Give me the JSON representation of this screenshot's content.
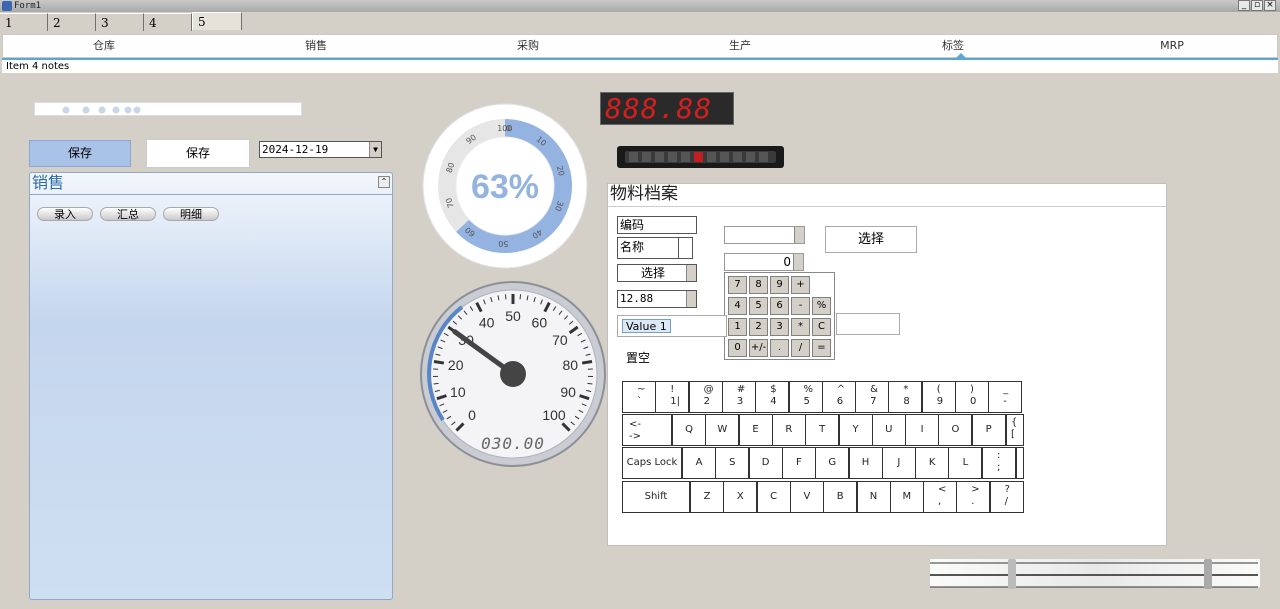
{
  "window": {
    "title": "Form1"
  },
  "top_tabs": [
    "1",
    "2",
    "3",
    "4",
    "5"
  ],
  "nav": {
    "items": [
      "仓库",
      "销售",
      "采购",
      "生产",
      "标签",
      "MRP"
    ],
    "selected_index": 4
  },
  "notes": "Item 4 notes",
  "toolbar": {
    "save_label_1": "保存",
    "save_label_2": "保存",
    "date_value": "2024-12-19"
  },
  "sales_panel": {
    "title": "销售",
    "buttons": [
      "录入",
      "汇总",
      "明细"
    ]
  },
  "progress_gauge": {
    "label": "63%",
    "value": 63,
    "ticks": [
      "0",
      "10",
      "20",
      "30",
      "40",
      "50",
      "60",
      "70",
      "80",
      "90",
      "100"
    ]
  },
  "led_display": {
    "text": "888.88"
  },
  "speedometer": {
    "ticks": [
      "0",
      "10",
      "20",
      "30",
      "40",
      "50",
      "60",
      "70",
      "80",
      "90",
      "100"
    ],
    "value": 30,
    "readout": "030.00"
  },
  "material_panel": {
    "title": "物料档案",
    "code_label": "编码",
    "name_label": "名称",
    "select_label": "选择",
    "select_button": "选择",
    "price_value": "12.88",
    "number_value": "0",
    "value_tag": "Value 1",
    "clear_label": "置空",
    "calculator": [
      [
        "7",
        "8",
        "9",
        "+",
        ""
      ],
      [
        "4",
        "5",
        "6",
        "-",
        "%"
      ],
      [
        "1",
        "2",
        "3",
        "*",
        "C"
      ],
      [
        "0",
        "+/-",
        ".",
        "/",
        "="
      ]
    ]
  },
  "keyboard": {
    "row1": [
      [
        "~",
        "`"
      ],
      [
        "!",
        "1|"
      ],
      [
        "@",
        "2"
      ],
      [
        "#",
        "3"
      ],
      [
        "$",
        "4"
      ],
      [
        "%",
        "5"
      ],
      [
        "^",
        "6"
      ],
      [
        "&",
        "7"
      ],
      [
        "*",
        "8"
      ],
      [
        "(",
        "9"
      ],
      [
        ")",
        "0"
      ],
      [
        "_",
        "-"
      ]
    ],
    "row2_lead": [
      "<-",
      "->"
    ],
    "row2": [
      "Q",
      "W",
      "E",
      "R",
      "T",
      "Y",
      "U",
      "I",
      "O",
      "P"
    ],
    "row2_end": [
      "{",
      "["
    ],
    "row3_lead": "Caps Lock",
    "row3": [
      "A",
      "S",
      "D",
      "F",
      "G",
      "H",
      "J",
      "K",
      "L"
    ],
    "row3_end": [
      ":",
      ";"
    ],
    "row4_lead": "Shift",
    "row4": [
      "Z",
      "X",
      "C",
      "V",
      "B",
      "N",
      "M"
    ],
    "row4_end": [
      [
        "<",
        ","
      ],
      [
        ">",
        "."
      ],
      [
        "?",
        "/"
      ]
    ]
  },
  "colors": {
    "accent": "#5aa7d6",
    "gauge_blue": "#94b3e0",
    "save_active": "#a9c2e8",
    "led_red": "#d21f1f"
  }
}
